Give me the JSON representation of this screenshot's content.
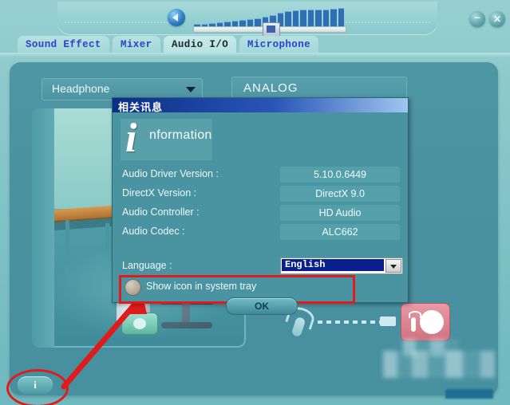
{
  "window": {
    "minimize_label": "–",
    "close_label": "✕"
  },
  "toolbar": {
    "volume_icon": "speaker-icon",
    "volume_bars": [
      4,
      4,
      5,
      6,
      7,
      8,
      9,
      10,
      11,
      13,
      15,
      18,
      20,
      21,
      22,
      22,
      22,
      22,
      23,
      24
    ]
  },
  "tabs": [
    {
      "label": "Sound Effect",
      "active": false
    },
    {
      "label": "Mixer",
      "active": false
    },
    {
      "label": "Audio I/O",
      "active": true
    },
    {
      "label": "Microphone",
      "active": false
    }
  ],
  "main": {
    "device_select": {
      "value": "Headphone",
      "arrow_icon": "chevron-down-icon"
    },
    "connector_panel_label": "ANALOG",
    "mic_icon": "microphone-icon",
    "green_jack": "headphone-jack",
    "pink_jack": "microphone-jack"
  },
  "info_button": {
    "label": "i",
    "name": "information-button"
  },
  "dialog": {
    "title": "相关讯息",
    "heading_initial": "i",
    "heading_rest": "nformation",
    "rows": [
      {
        "key": "Audio Driver Version :",
        "value": "5.10.0.6449"
      },
      {
        "key": "DirectX Version :",
        "value": "DirectX 9.0"
      },
      {
        "key": "Audio Controller :",
        "value": "HD Audio"
      },
      {
        "key": "Audio Codec :",
        "value": "ALC662"
      }
    ],
    "language": {
      "label": "Language :",
      "value": "English",
      "arrow_icon": "chevron-down-icon"
    },
    "tray_checkbox": {
      "label": "Show icon in system tray",
      "checked": false
    },
    "ok_label": "OK"
  },
  "colors": {
    "panel": "#4a91a0",
    "frame": "#8fc9c9",
    "dialog_title_start": "#0b2e86",
    "accent_red": "#e01b1b",
    "tab_text": "#2a42c8"
  }
}
